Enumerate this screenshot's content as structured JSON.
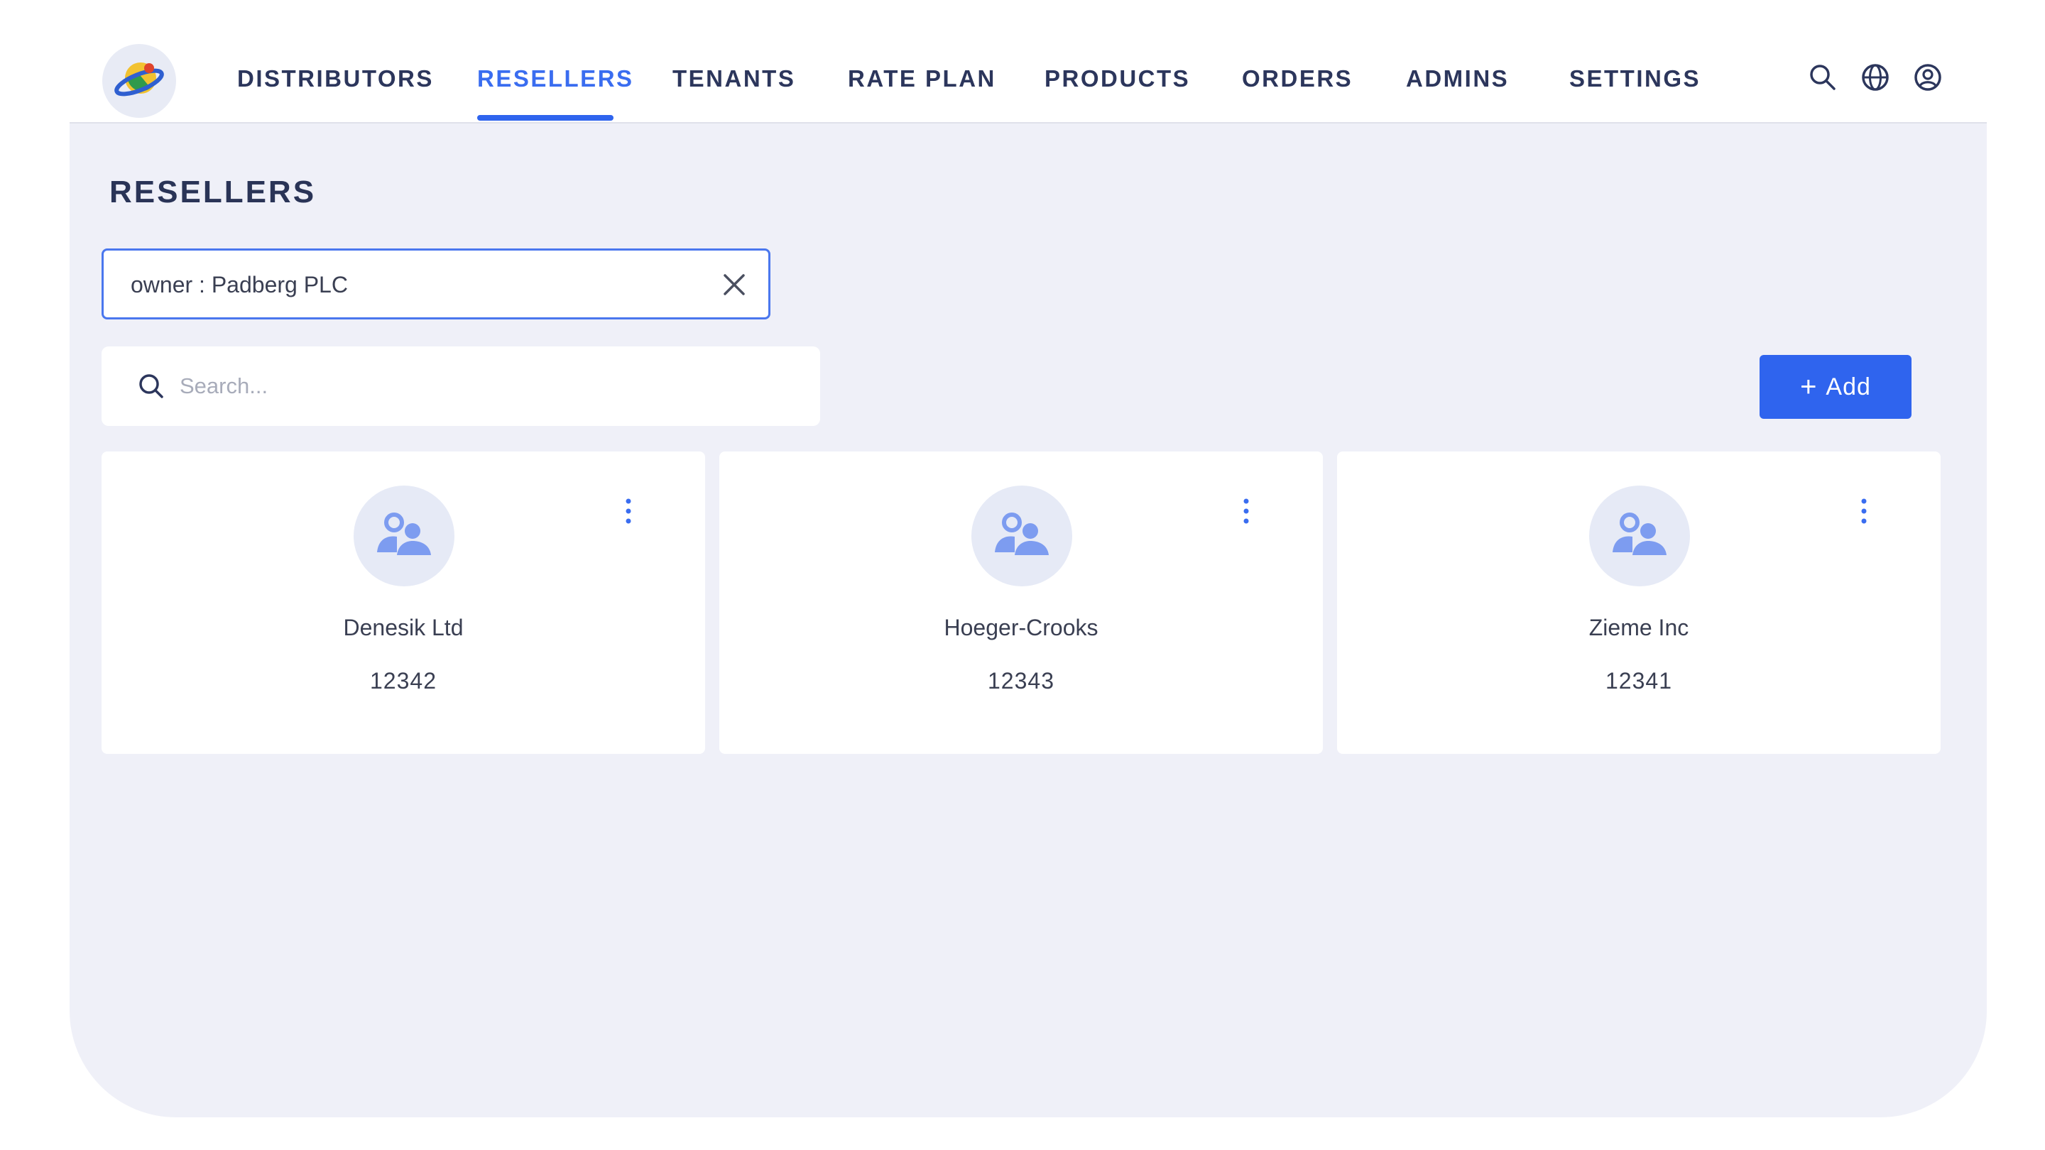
{
  "header": {
    "logo": "planet-logo-icon",
    "nav": [
      {
        "label": "DISTRIBUTORS",
        "active": false
      },
      {
        "label": "RESELLERS",
        "active": true
      },
      {
        "label": "TENANTS",
        "active": false
      },
      {
        "label": "RATE PLAN",
        "active": false
      },
      {
        "label": "PRODUCTS",
        "active": false
      },
      {
        "label": "ORDERS",
        "active": false
      },
      {
        "label": "ADMINS",
        "active": false
      },
      {
        "label": "SETTINGS",
        "active": false
      }
    ],
    "icons": [
      "search-icon",
      "globe-icon",
      "user-account-icon"
    ]
  },
  "page": {
    "title": "RESELLERS"
  },
  "filter": {
    "text": "owner : Padberg PLC",
    "clear_icon": "close-icon"
  },
  "search": {
    "placeholder": "Search..."
  },
  "toolbar": {
    "add_plus": "+",
    "add_label": "Add"
  },
  "resellers": [
    {
      "name": "Denesik Ltd",
      "id": "12342"
    },
    {
      "name": "Hoeger-Crooks",
      "id": "12343"
    },
    {
      "name": "Zieme Inc",
      "id": "12341"
    }
  ],
  "colors": {
    "accent": "#2f64ee",
    "nav_text": "#2c365c",
    "background": "#eff0f8",
    "avatar_bg": "#e6eaf6",
    "avatar_icon": "#7d9cf0"
  }
}
